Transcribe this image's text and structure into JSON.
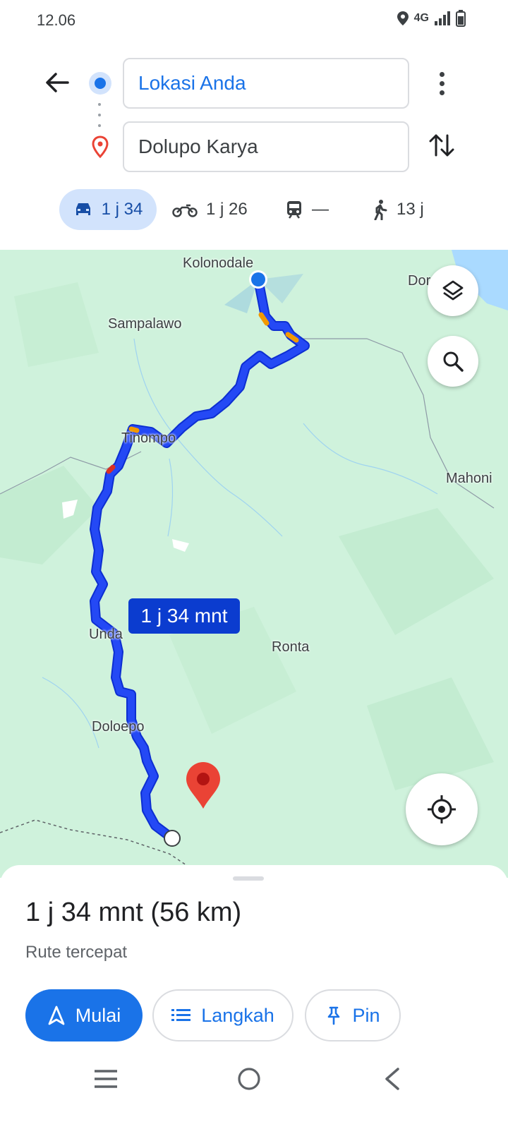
{
  "status_bar": {
    "time": "12.06",
    "network": "4G"
  },
  "directions": {
    "origin": "Lokasi Anda",
    "destination": "Dolupo Karya",
    "modes": [
      {
        "name": "car",
        "label": "1 j 34",
        "icon": "car-icon",
        "active": true
      },
      {
        "name": "motorcycle",
        "label": "1 j 26",
        "icon": "motorcycle-icon"
      },
      {
        "name": "transit",
        "label": "—",
        "icon": "train-icon"
      },
      {
        "name": "walk",
        "label": "13 j",
        "icon": "walk-icon"
      }
    ]
  },
  "map": {
    "labels": {
      "kolonodale": "Kolonodale",
      "dor": "Dor",
      "sampalawo": "Sampalawo",
      "tinompo": "Tinompo",
      "mahoni": "Mahoni",
      "undano": "Unda",
      "ronta": "Ronta",
      "doloepo": "Doloepo"
    },
    "route_badge": "1 j 34 mnt",
    "colors": {
      "land": "#cff2dc",
      "water": "#aadaff",
      "route": "#1a3ef0",
      "traffic": "#f29900",
      "pin": "#ea4335"
    }
  },
  "sheet": {
    "summary": "1 j 34 mnt (56 km)",
    "subtext": "Rute tercepat",
    "buttons": {
      "start": "Mulai",
      "steps": "Langkah",
      "pin": "Pin"
    }
  }
}
